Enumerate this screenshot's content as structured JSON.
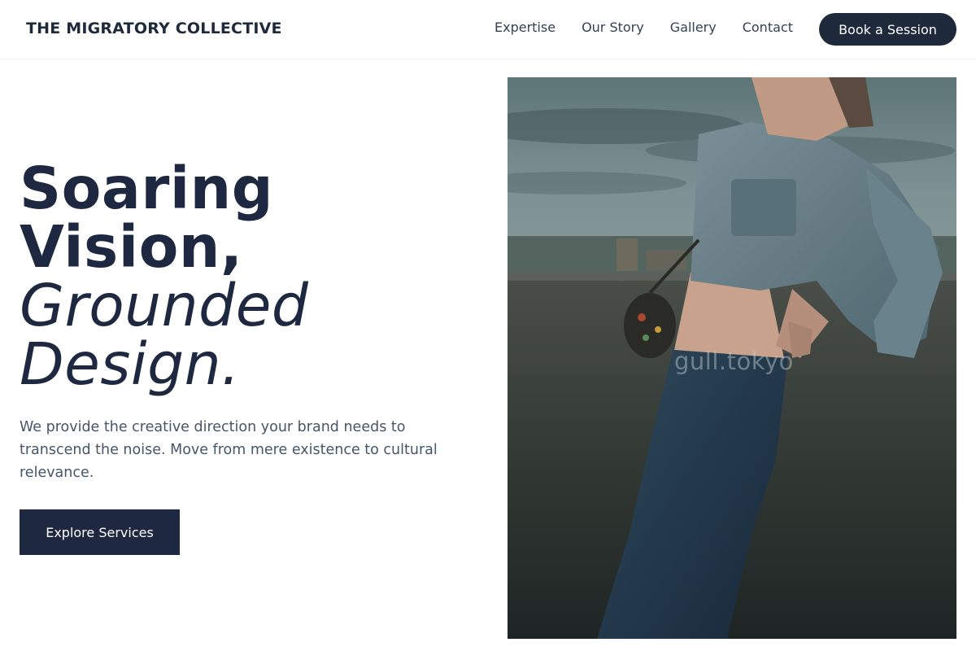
{
  "brand": {
    "name": "THE MIGRATORY COLLECTIVE"
  },
  "nav": {
    "links": [
      "Expertise",
      "Our Story",
      "Gallery",
      "Contact"
    ],
    "cta_label": "Book a Session"
  },
  "hero": {
    "title_line1": "Soaring",
    "title_line2": "Vision,",
    "title_line3": "Grounded",
    "title_line4": "Design.",
    "subtitle": "We provide the creative direction your brand needs to transcend the noise. Move from mere existence to cultural relevance.",
    "button_label": "Explore Services",
    "image": {
      "watermark": "gull.tokyo"
    }
  },
  "colors": {
    "primary": "#1e2840",
    "text_muted": "#475569",
    "nav_text": "#334155",
    "background": "#ffffff"
  }
}
